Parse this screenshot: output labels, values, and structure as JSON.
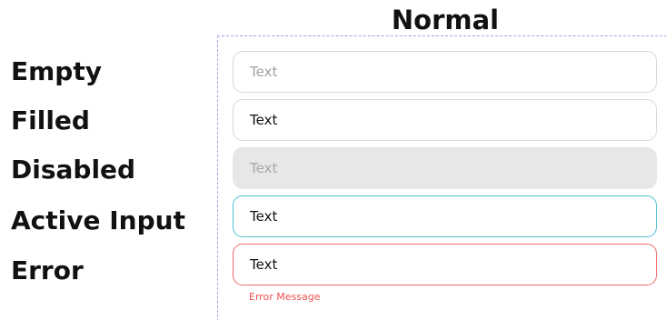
{
  "column": {
    "title": "Normal"
  },
  "rows": [
    {
      "label": "Empty",
      "text": "Text"
    },
    {
      "label": "Filled",
      "text": "Text"
    },
    {
      "label": "Disabled",
      "text": "Text"
    },
    {
      "label": "Active Input",
      "text": "Text"
    },
    {
      "label": "Error",
      "text": "Text",
      "error_message": "Error Message"
    }
  ],
  "colors": {
    "frame_dash": "#a3a0ee",
    "default_border": "#d8d8d8",
    "disabled_fill": "#e6e7e9",
    "active_border": "#4fc3d4",
    "error_border": "#f26b6b",
    "error_text": "#f05050"
  }
}
